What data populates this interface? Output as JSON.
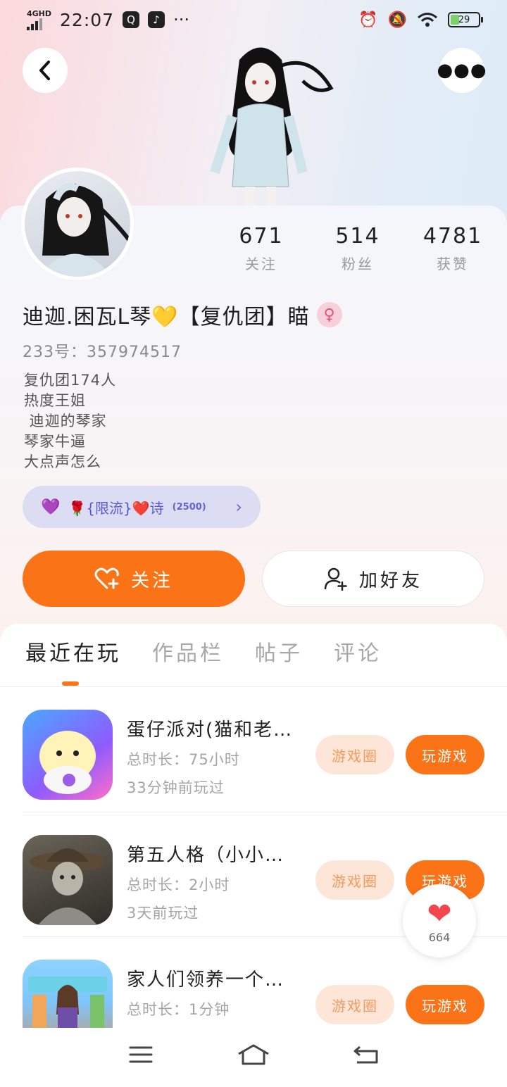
{
  "status_bar": {
    "network": "4GHD",
    "time": "22:07",
    "battery": "29",
    "more": "···"
  },
  "profile": {
    "stats": [
      {
        "value": "671",
        "label": "关注"
      },
      {
        "value": "514",
        "label": "粉丝"
      },
      {
        "value": "4781",
        "label": "获赞"
      }
    ],
    "username": "迪迦.困瓦L琴💛【复仇团】瞄",
    "gender_symbol": "♀",
    "uid": "233号：357974517",
    "bio_lines": [
      "复仇团174人",
      "热度王姐",
      " 迪迦的琴家",
      "琴家牛逼",
      "大点声怎么"
    ],
    "tag": {
      "hearts": "💜",
      "text": "🌹{限流}❤️诗",
      "count": "(2500)",
      "arrow": "›"
    }
  },
  "actions": {
    "follow_label": "关注",
    "add_friend_label": "加好友"
  },
  "tabs": [
    "最近在玩",
    "作品栏",
    "帖子",
    "评论"
  ],
  "games": [
    {
      "title": "蛋仔派对(猫和老…",
      "total": "总时长：75小时",
      "last": "33分钟前玩过",
      "circle_label": "游戏圈",
      "play_label": "玩游戏"
    },
    {
      "title": "第五人格（小小…",
      "total": "总时长：2小时",
      "last": "3天前玩过",
      "circle_label": "游戏圈",
      "play_label": "玩游戏"
    },
    {
      "title": "家人们领养一个…",
      "total": "总时长：1分钟",
      "last": "",
      "circle_label": "游戏圈",
      "play_label": "玩游戏"
    }
  ],
  "like_fab": {
    "count": "664"
  },
  "colors": {
    "accent": "#fb7317",
    "tag_bg": "#dcdcf3",
    "circle_bg": "#fde6d7"
  },
  "icons": {
    "back": "chevron-left-icon",
    "more": "more-horizontal-icon",
    "follow": "heart-plus-icon",
    "add_friend": "user-plus-icon",
    "like": "heart-icon",
    "nav": [
      "menu-icon",
      "home-icon",
      "back-icon"
    ]
  }
}
